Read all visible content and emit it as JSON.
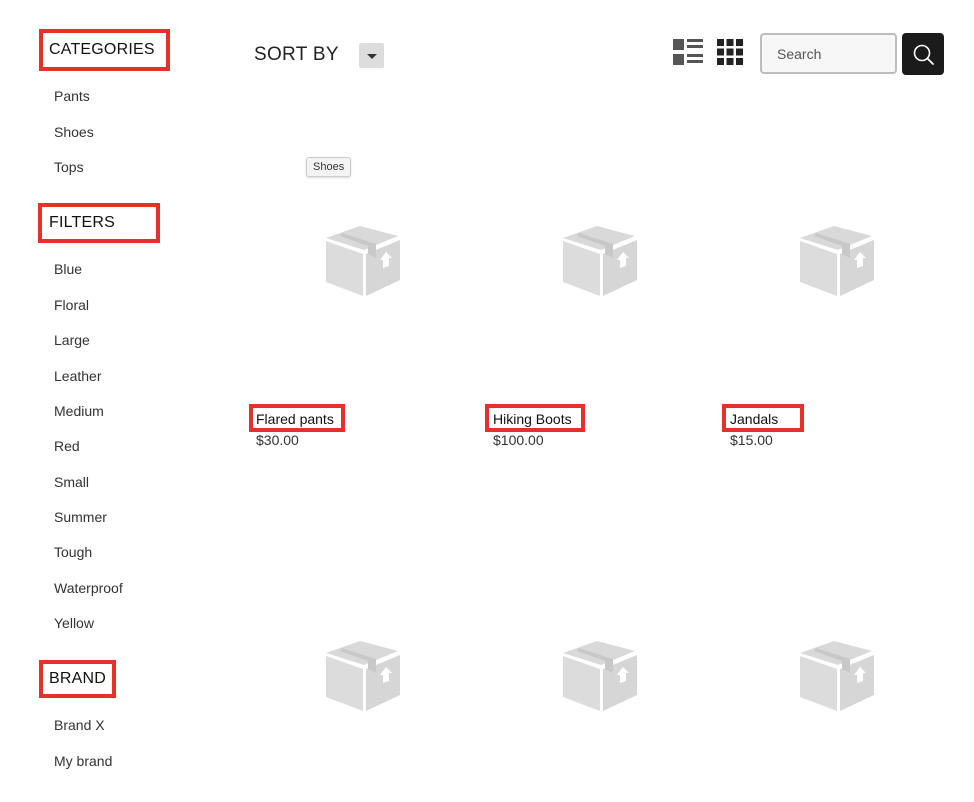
{
  "sidebar": {
    "categories": {
      "title": "CATEGORIES",
      "items": [
        "Pants",
        "Shoes",
        "Tops"
      ]
    },
    "filters": {
      "title": "FILTERS",
      "items": [
        "Blue",
        "Floral",
        "Large",
        "Leather",
        "Medium",
        "Red",
        "Small",
        "Summer",
        "Tough",
        "Waterproof",
        "Yellow"
      ]
    },
    "brand": {
      "title": "BRAND",
      "items": [
        "Brand X",
        "My brand"
      ]
    }
  },
  "toolbar": {
    "sort_label": "SORT BY",
    "tooltip": "Shoes",
    "search_placeholder": "Search"
  },
  "products": [
    {
      "name": "Flared pants",
      "price": "$30.00"
    },
    {
      "name": "Hiking Boots",
      "price": "$100.00"
    },
    {
      "name": "Jandals",
      "price": "$15.00"
    }
  ],
  "colors": {
    "highlight": "#e8302a",
    "search_button": "#1b1b1b",
    "placeholder_icon": "#d9d9d9"
  },
  "icons": [
    "list-view-icon",
    "grid-view-icon",
    "search-icon",
    "chevron-down-icon",
    "product-placeholder-icon"
  ]
}
